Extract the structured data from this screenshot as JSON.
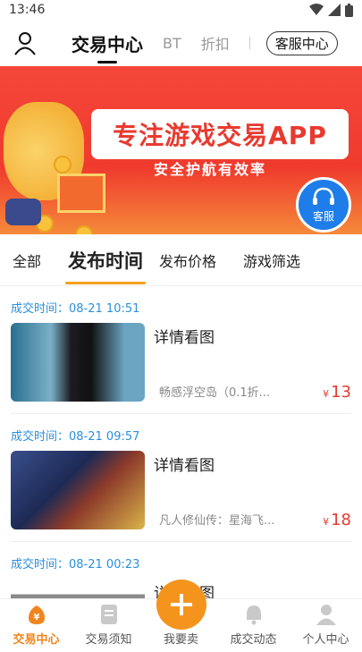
{
  "status_bar": {
    "time": "13:46"
  },
  "header": {
    "tabs": [
      {
        "label": "交易中心"
      },
      {
        "label": "BT"
      },
      {
        "label": "折扣"
      }
    ],
    "service_label": "客服中心"
  },
  "banner": {
    "title": "专注游戏交易APP",
    "subtitle": "安全护航有效率",
    "service_label": "客服"
  },
  "filters": [
    {
      "label": "全部"
    },
    {
      "label": "发布时间"
    },
    {
      "label": "发布价格"
    },
    {
      "label": "游戏筛选"
    }
  ],
  "deals": [
    {
      "time_label": "成交时间：",
      "time": "08-21 10:51",
      "detail": "详情看图",
      "game": "畅感浮空岛（0.1折...",
      "currency": "¥",
      "price": "13"
    },
    {
      "time_label": "成交时间：",
      "time": "08-21 09:57",
      "detail": "详情看图",
      "game": "凡人修仙传：星海飞...",
      "currency": "¥",
      "price": "18"
    },
    {
      "time_label": "成交时间：",
      "time": "08-21 00:23",
      "detail": "详情看图",
      "game": "",
      "currency": "",
      "price": ""
    }
  ],
  "bottom_nav": [
    {
      "label": "交易中心",
      "icon": "trade-center-icon"
    },
    {
      "label": "交易须知",
      "icon": "notice-icon"
    },
    {
      "label": "我要卖",
      "icon": "plus-icon"
    },
    {
      "label": "成交动态",
      "icon": "bell-icon"
    },
    {
      "label": "个人中心",
      "icon": "person-icon"
    }
  ],
  "colors": {
    "accent": "#f5941d",
    "price": "#e83a2f",
    "time": "#2a8fe0",
    "banner": "#f03a2e"
  }
}
